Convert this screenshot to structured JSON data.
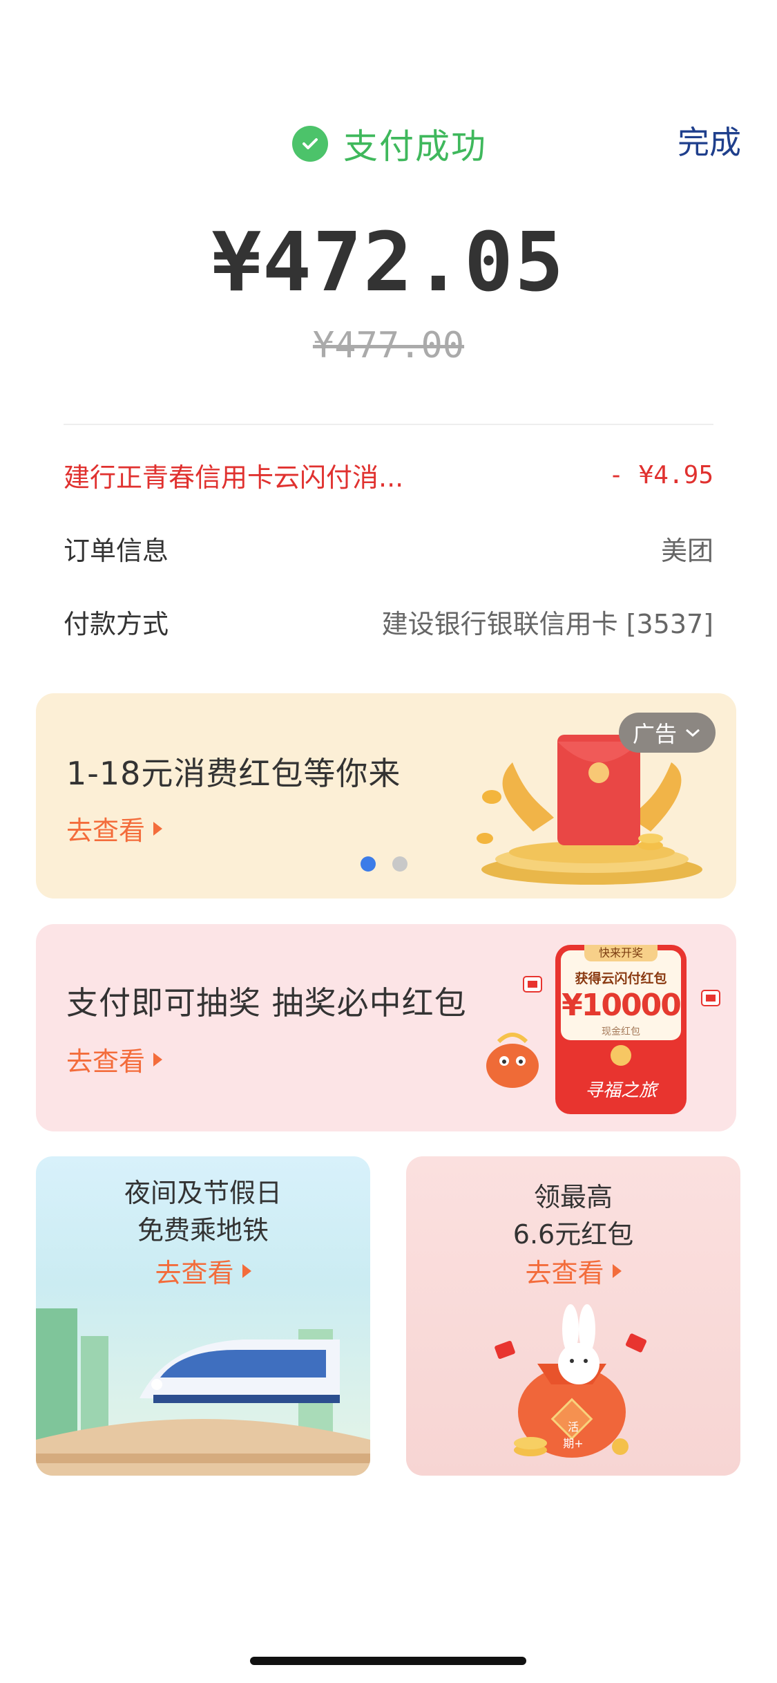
{
  "header": {
    "status_text": "支付成功",
    "done_label": "完成",
    "status_color": "#3fb85c",
    "done_color": "#1f3f8c"
  },
  "payment": {
    "amount": "¥472.05",
    "original_amount": "¥477.00"
  },
  "details": {
    "discount_label": "建行正青春信用卡云闪付消...",
    "discount_value": "- ¥4.95",
    "order_label": "订单信息",
    "order_value": "美团",
    "method_label": "付款方式",
    "method_value": "建设银行银联信用卡 [3537]"
  },
  "banner1": {
    "title": "1-18元消费红包等你来",
    "link": "去查看",
    "ad_label": "广告",
    "carousel_total": 2,
    "carousel_active": 1
  },
  "banner2": {
    "title": "支付即可抽奖 抽奖必中红包",
    "link": "去查看",
    "promo_tag": "快来开奖",
    "promo_title": "获得云闪付红包",
    "promo_amount": "¥10000",
    "promo_sub": "现金红包",
    "promo_brand": "寻福之旅"
  },
  "tiles": [
    {
      "line1": "夜间及节假日",
      "line2": "免费乘地铁",
      "link": "去查看"
    },
    {
      "line1": "领最高",
      "line2": "6.6元红包",
      "link": "去查看",
      "bag_label": "活期+"
    }
  ],
  "colors": {
    "accent_orange": "#f36c3b",
    "discount_red": "#e0312f",
    "dot_active": "#3c7ce8"
  }
}
